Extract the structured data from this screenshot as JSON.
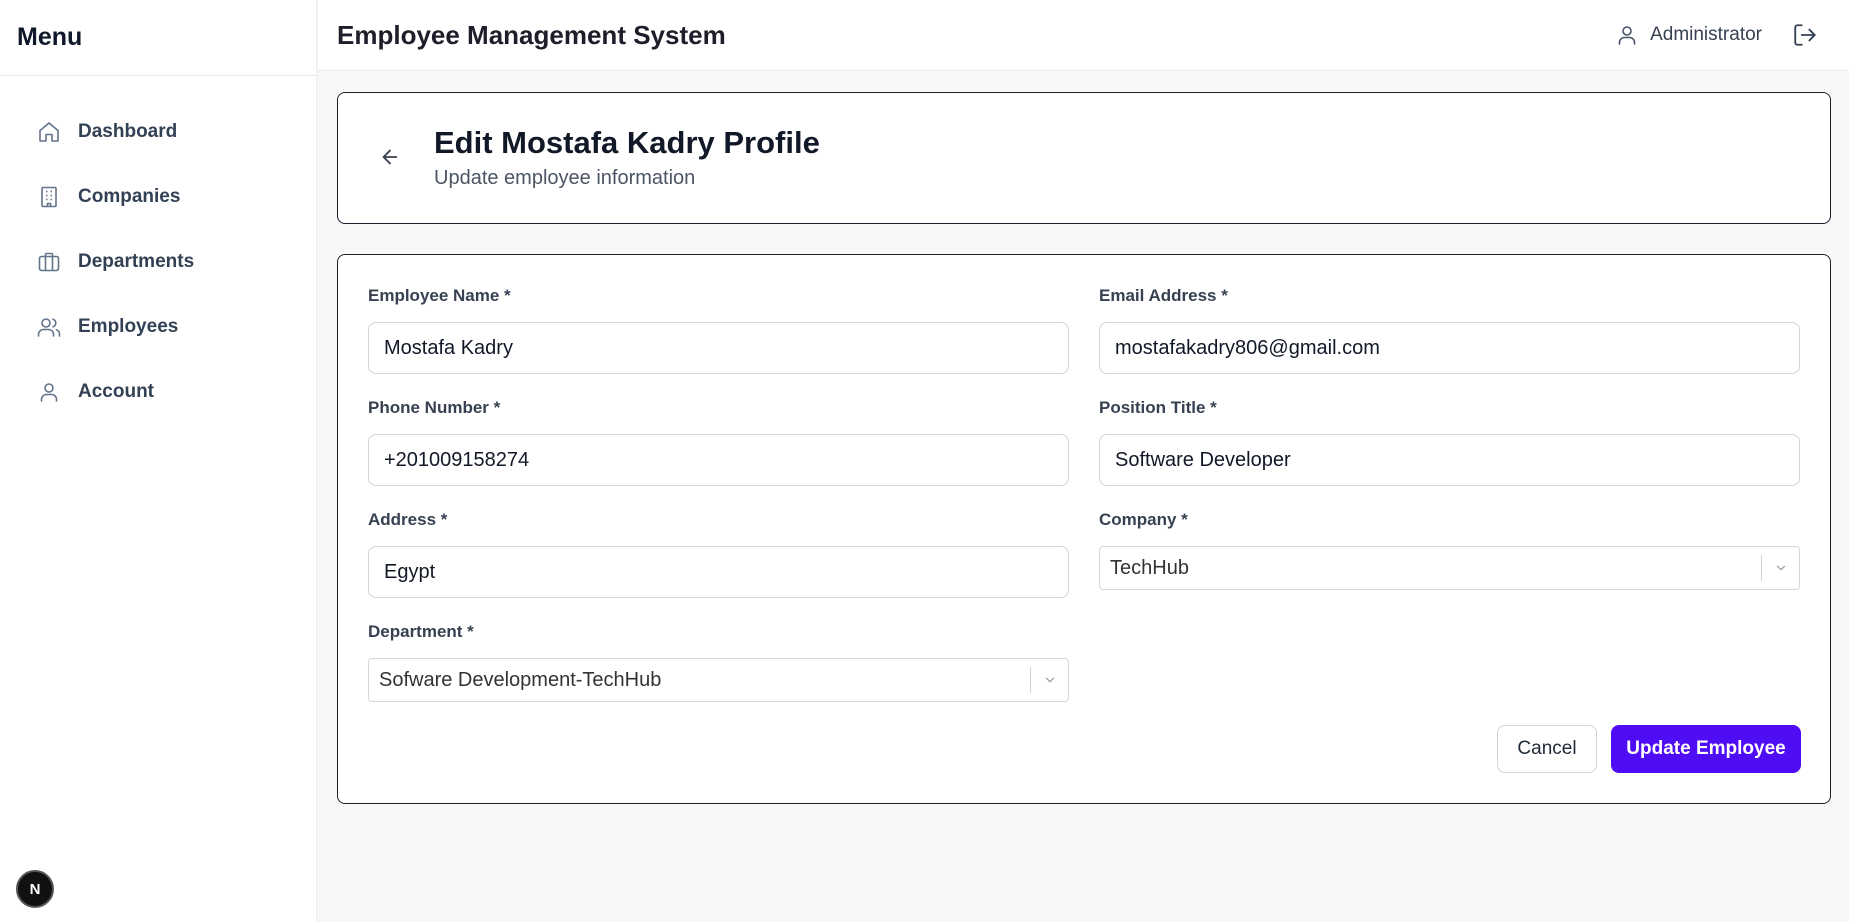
{
  "sidebar": {
    "title": "Menu",
    "items": [
      {
        "label": "Dashboard",
        "icon": "home-icon"
      },
      {
        "label": "Companies",
        "icon": "building-icon"
      },
      {
        "label": "Departments",
        "icon": "briefcase-icon"
      },
      {
        "label": "Employees",
        "icon": "users-icon"
      },
      {
        "label": "Account",
        "icon": "user-icon"
      }
    ],
    "badge": "N"
  },
  "header": {
    "app_title": "Employee Management System",
    "user_name": "Administrator"
  },
  "page": {
    "title": "Edit Mostafa Kadry Profile",
    "subtitle": "Update employee information"
  },
  "form": {
    "employee_name": {
      "label": "Employee Name *",
      "value": "Mostafa Kadry"
    },
    "email": {
      "label": "Email Address *",
      "value": "mostafakadry806@gmail.com"
    },
    "phone": {
      "label": "Phone Number *",
      "value": "+201009158274"
    },
    "position": {
      "label": "Position Title *",
      "value": "Software Developer"
    },
    "address": {
      "label": "Address *",
      "value": "Egypt"
    },
    "company": {
      "label": "Company *",
      "value": "TechHub"
    },
    "department": {
      "label": "Department *",
      "value": "Sofware Development-TechHub"
    },
    "cancel_label": "Cancel",
    "submit_label": "Update Employee"
  },
  "colors": {
    "accent": "#4f0df5",
    "border_dark": "#1f1f2e",
    "background": "#f7f7f8"
  }
}
